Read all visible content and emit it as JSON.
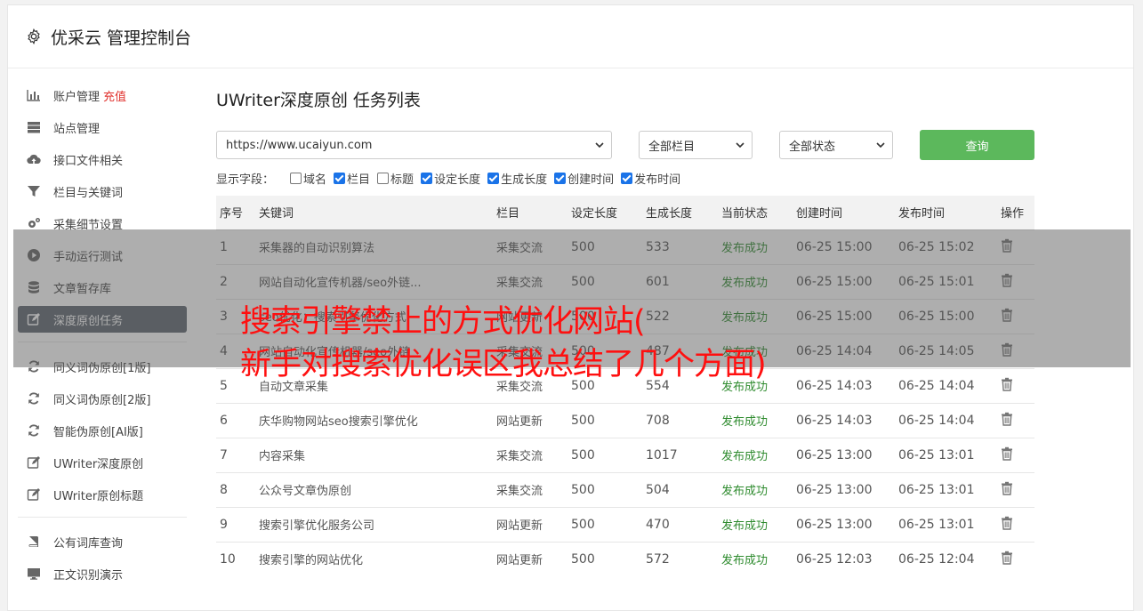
{
  "app": {
    "title": "优采云 管理控制台",
    "icon": "gear-icon"
  },
  "sidebar": {
    "items": [
      {
        "label": "账户管理",
        "extra": "充值",
        "icon": "bar-chart-icon"
      },
      {
        "label": "站点管理",
        "icon": "server-icon"
      },
      {
        "label": "接口文件相关",
        "icon": "cloud-upload-icon"
      },
      {
        "label": "栏目与关键词",
        "icon": "filter-icon"
      },
      {
        "label": "采集细节设置",
        "icon": "cogs-icon"
      },
      {
        "label": "手动运行测试",
        "icon": "play-circle-icon"
      },
      {
        "label": "文章暂存库",
        "icon": "database-icon"
      },
      {
        "label": "深度原创任务",
        "icon": "edit-icon",
        "active": true
      }
    ],
    "items2": [
      {
        "label": "同义词伪原创[1版]",
        "icon": "refresh-icon"
      },
      {
        "label": "同义词伪原创[2版]",
        "icon": "refresh-icon"
      },
      {
        "label": "智能伪原创[AI版]",
        "icon": "refresh-icon"
      },
      {
        "label": "UWriter深度原创",
        "icon": "edit-icon"
      },
      {
        "label": "UWriter原创标题",
        "icon": "edit-icon"
      }
    ],
    "items3": [
      {
        "label": "公有词库查询",
        "icon": "book-icon"
      },
      {
        "label": "正文识别演示",
        "icon": "monitor-icon"
      }
    ]
  },
  "main": {
    "title": "UWriter深度原创 任务列表",
    "site_select": "https://www.ucaiyun.com",
    "column_select": "全部栏目",
    "status_select": "全部状态",
    "query_label": "查询",
    "fields_label": "显示字段：",
    "fields": [
      {
        "label": "域名",
        "checked": false
      },
      {
        "label": "栏目",
        "checked": true
      },
      {
        "label": "标题",
        "checked": false
      },
      {
        "label": "设定长度",
        "checked": true
      },
      {
        "label": "生成长度",
        "checked": true
      },
      {
        "label": "创建时间",
        "checked": true
      },
      {
        "label": "发布时间",
        "checked": true
      }
    ],
    "table": {
      "headers": [
        "序号",
        "关键词",
        "栏目",
        "设定长度",
        "生成长度",
        "当前状态",
        "创建时间",
        "发布时间",
        "操作"
      ],
      "rows": [
        [
          "1",
          "采集器的自动识别算法",
          "采集交流",
          "500",
          "533",
          "发布成功",
          "06-25 15:00",
          "06-25 15:02"
        ],
        [
          "2",
          "网站自动化宣传机器/seo外链...",
          "采集交流",
          "500",
          "601",
          "发布成功",
          "06-25 15:00",
          "06-25 15:01"
        ],
        [
          "3",
          "seo优化：搜索引擎优化方式",
          "网站更新",
          "500",
          "522",
          "发布成功",
          "06-25 15:00",
          "06-25 15:00"
        ],
        [
          "4",
          "网站自动化宣传机器/seo外链",
          "采集交流",
          "500",
          "487",
          "发布成功",
          "06-25 14:04",
          "06-25 14:05"
        ],
        [
          "5",
          "自动文章采集",
          "采集交流",
          "500",
          "554",
          "发布成功",
          "06-25 14:03",
          "06-25 14:04"
        ],
        [
          "6",
          "庆华购物网站seo搜索引擎优化",
          "网站更新",
          "500",
          "708",
          "发布成功",
          "06-25 14:03",
          "06-25 14:04"
        ],
        [
          "7",
          "内容采集",
          "采集交流",
          "500",
          "1017",
          "发布成功",
          "06-25 13:00",
          "06-25 13:01"
        ],
        [
          "8",
          "公众号文章伪原创",
          "采集交流",
          "500",
          "504",
          "发布成功",
          "06-25 13:00",
          "06-25 13:01"
        ],
        [
          "9",
          "搜索引擎优化服务公司",
          "网站更新",
          "500",
          "470",
          "发布成功",
          "06-25 13:00",
          "06-25 13:01"
        ],
        [
          "10",
          "搜索引擎的网站优化",
          "网站更新",
          "500",
          "572",
          "发布成功",
          "06-25 12:03",
          "06-25 12:04"
        ]
      ]
    }
  },
  "overlay": {
    "line1": "搜索引擎禁止的方式优化网站(",
    "line2": "新手对搜索优化误区我总结了几个方面)",
    "color": "#ff1010"
  }
}
